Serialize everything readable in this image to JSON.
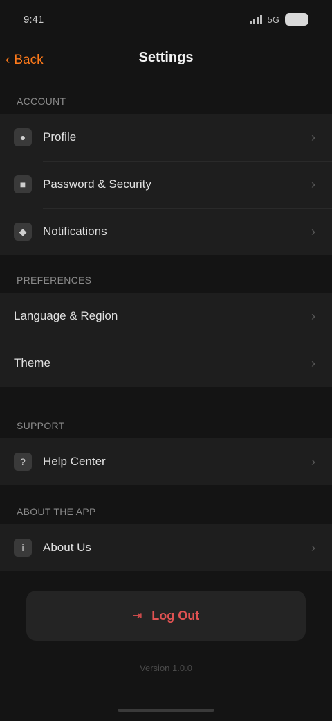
{
  "status_bar": {
    "time": "9:41",
    "network": "5G"
  },
  "nav": {
    "back_label": "Back",
    "title": "Settings"
  },
  "sections": {
    "account": {
      "header": "ACCOUNT",
      "items": [
        {
          "label": "Profile",
          "icon": "person-icon"
        },
        {
          "label": "Password & Security",
          "icon": "lock-icon"
        },
        {
          "label": "Notifications",
          "icon": "bell-icon"
        }
      ]
    },
    "preferences": {
      "header": "PREFERENCES",
      "items": [
        {
          "label": "Language & Region"
        },
        {
          "label": "Theme"
        }
      ]
    },
    "support": {
      "header": "SUPPORT",
      "items": [
        {
          "label": "Help Center",
          "icon": "help-icon"
        }
      ]
    },
    "about": {
      "header": "ABOUT THE APP",
      "items": [
        {
          "label": "About Us",
          "icon": "info-icon"
        }
      ]
    }
  },
  "logout": {
    "label": "Log Out"
  },
  "version": "Version 1.0.0",
  "colors": {
    "background": "#141414",
    "accent": "#ff7a1a",
    "danger": "#e05252"
  }
}
